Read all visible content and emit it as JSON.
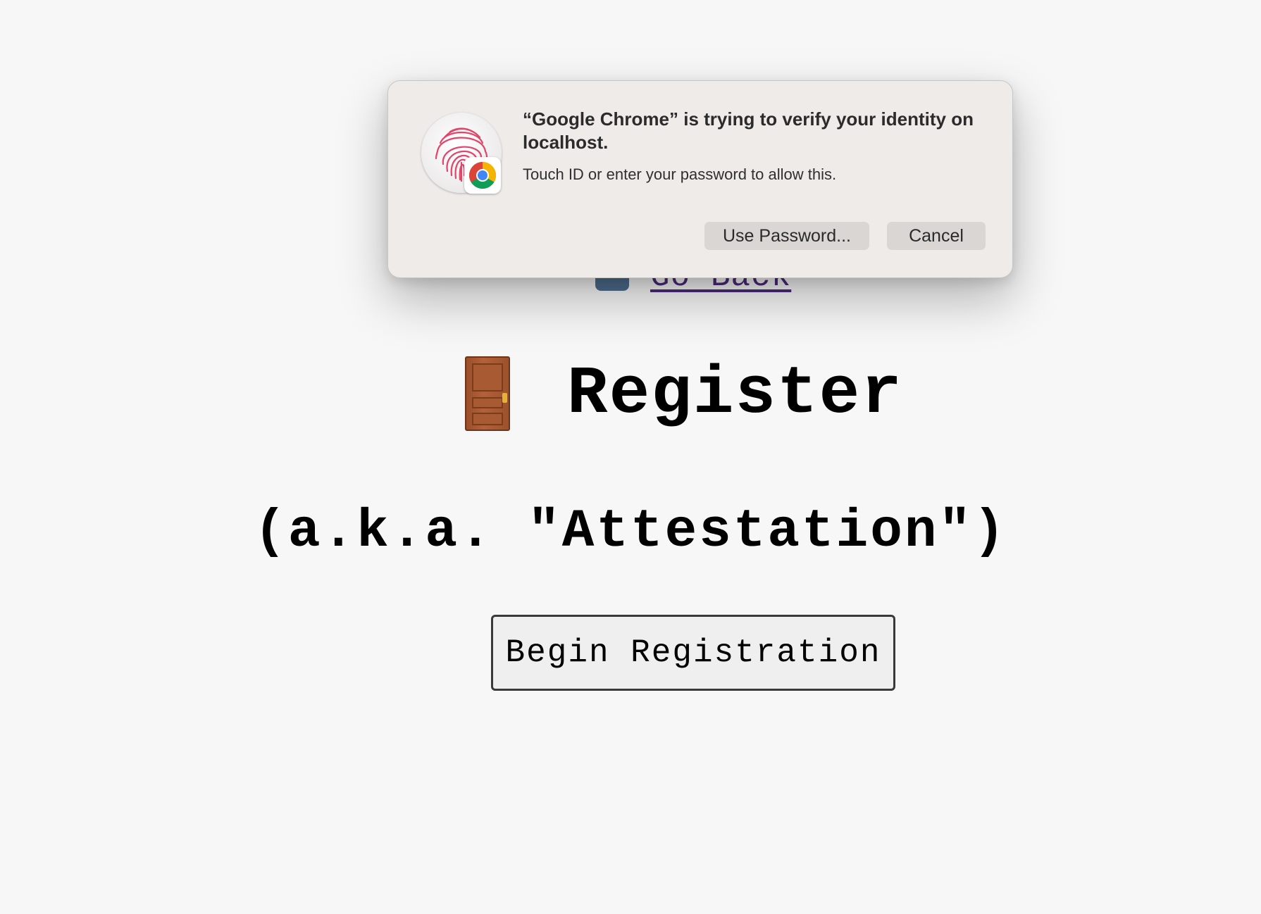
{
  "page": {
    "back_link": "Go Back",
    "title": "Register",
    "subtitle": "(a.k.a. \"Attestation\")",
    "begin_button": "Begin Registration",
    "title_icon": "door-icon"
  },
  "dialog": {
    "title": "“Google Chrome” is trying to verify your identity on localhost.",
    "message": "Touch ID or enter your password to allow this.",
    "use_password_label": "Use Password...",
    "cancel_label": "Cancel",
    "icon": "fingerprint-icon",
    "badge_icon": "chrome-icon"
  },
  "colors": {
    "page_background": "#f7f7f7",
    "dialog_background": "#efebe9",
    "fingerprint": "#e0456a",
    "link": "#4a2a7a"
  }
}
